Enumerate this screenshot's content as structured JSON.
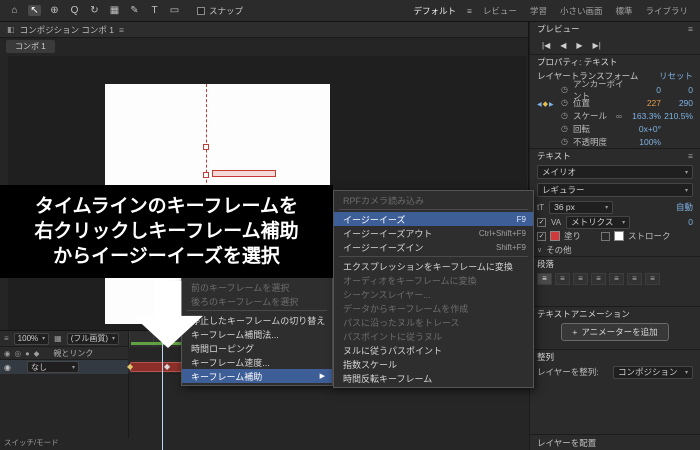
{
  "colors": {
    "accent_blue": "#7eb1e3",
    "menu_highlight": "#3d5e97",
    "value_orange": "#e09a52",
    "layer_bar_red": "#8c2f2a",
    "cache_green": "#5fa243"
  },
  "topbar": {
    "tools": [
      {
        "name": "home",
        "glyph": "⌂"
      },
      {
        "name": "selection",
        "glyph": "↖"
      },
      {
        "name": "hand",
        "glyph": "⊕"
      },
      {
        "name": "zoom",
        "glyph": "Q"
      },
      {
        "name": "rotate",
        "glyph": "↻"
      },
      {
        "name": "camera",
        "glyph": "▦"
      },
      {
        "name": "pen",
        "glyph": "✎"
      },
      {
        "name": "type",
        "glyph": "T"
      },
      {
        "name": "shape",
        "glyph": "▭"
      }
    ],
    "snap_label": "スナップ",
    "workspaces": [
      "デフォルト",
      "レビュー",
      "学習",
      "小さい画面",
      "標準",
      "ライブラリ"
    ]
  },
  "comp_panel": {
    "tab_title": "コンポジション コンポ 1",
    "subtab": "コンポ 1",
    "zoom_value": "100%",
    "quality_value": "(フル画質)"
  },
  "preview": {
    "title": "プレビュー",
    "buttons": [
      "|◀",
      "◀",
      "▶",
      "▶|"
    ]
  },
  "properties": {
    "title": "プロパティ: テキスト",
    "transform_title": "レイヤートランスフォーム",
    "reset_label": "リセット",
    "rows": [
      {
        "label": "アンカーポイント",
        "v1": "0",
        "v2": "0"
      },
      {
        "label": "位置",
        "v1": "227",
        "v2": "290"
      },
      {
        "label": "スケール",
        "v1": "163.3%",
        "v2": "210.5%"
      },
      {
        "label": "回転",
        "v1": "0x+0°",
        "v2": ""
      },
      {
        "label": "不透明度",
        "v1": "100%",
        "v2": ""
      }
    ]
  },
  "text_section": {
    "title": "テキスト",
    "font_family": "メイリオ",
    "font_style": "レギュラー",
    "font_size": "36 px",
    "auto_label": "自動",
    "metrics_label": "メトリクス",
    "tracking_value": "0",
    "fill_label": "塗り",
    "stroke_label": "ストローク",
    "more_label": "その他"
  },
  "paragraph": {
    "title": "段落"
  },
  "text_animation": {
    "title": "テキストアニメーション",
    "add_animator_label": "アニメーターを追加"
  },
  "align": {
    "title": "整列",
    "align_layers_label": "レイヤーを整列:",
    "align_target_value": "コンポジション",
    "distribute_label": "レイヤーを配置"
  },
  "timeline": {
    "parent_link_header": "親とリンク",
    "layer_parent_value": "なし",
    "switches_label": "スイッチ/モード"
  },
  "instruction_overlay": {
    "line1": "タイムラインのキーフレームを",
    "line2": "右クリックしキーフレーム補助",
    "line3": "からイージーイーズを選択"
  },
  "context_menu": {
    "items": [
      {
        "label": "前のキーフレームを選択",
        "disabled": true
      },
      {
        "label": "後ろのキーフレームを選択",
        "disabled": true
      },
      {
        "type": "separator"
      },
      {
        "label": "停止したキーフレームの切り替え"
      },
      {
        "label": "キーフレーム補間法..."
      },
      {
        "label": "時間ローピング"
      },
      {
        "label": "キーフレーム速度..."
      },
      {
        "label": "キーフレーム補助",
        "highlighted": true,
        "has_submenu": true
      }
    ]
  },
  "submenu": {
    "items": [
      {
        "label": "RPFカメラ読み込み",
        "disabled": true
      },
      {
        "type": "separator"
      },
      {
        "label": "イージーイーズ",
        "shortcut": "F9",
        "highlighted": true
      },
      {
        "label": "イージーイーズアウト",
        "shortcut": "Ctrl+Shift+F9"
      },
      {
        "label": "イージーイーズイン",
        "shortcut": "Shift+F9"
      },
      {
        "type": "separator"
      },
      {
        "label": "エクスプレッションをキーフレームに変換"
      },
      {
        "label": "オーディオをキーフレームに変換",
        "disabled": true
      },
      {
        "label": "シーケンスレイヤー...",
        "disabled": true
      },
      {
        "label": "データからキーフレームを作成",
        "disabled": true
      },
      {
        "label": "パスに沿ったヌルをトレース",
        "disabled": true
      },
      {
        "label": "パスポイントに従うヌル",
        "disabled": true
      },
      {
        "label": "ヌルに従うパスポイント"
      },
      {
        "label": "指数スケール"
      },
      {
        "label": "時間反転キーフレーム"
      }
    ]
  }
}
